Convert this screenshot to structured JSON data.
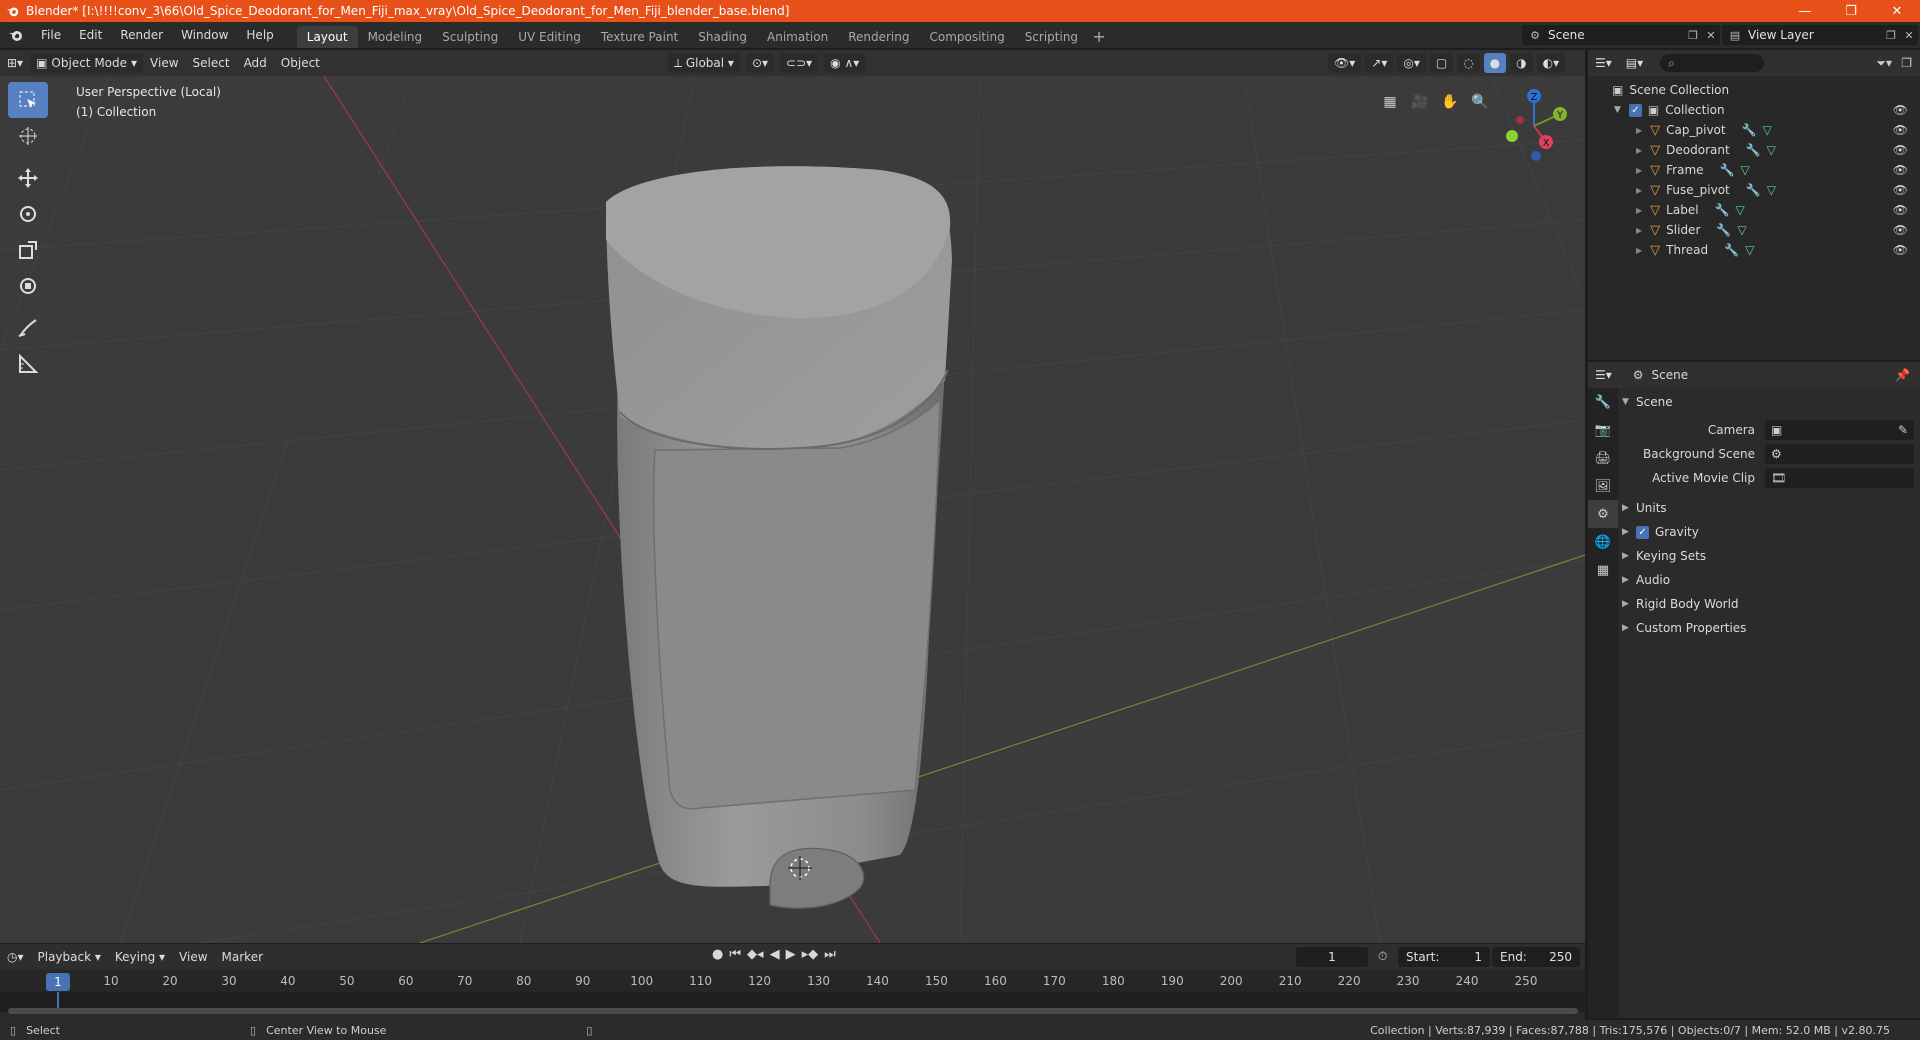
{
  "window": {
    "title": "Blender* [I:\\!!!!conv_3\\66\\Old_Spice_Deodorant_for_Men_Fiji_max_vray\\Old_Spice_Deodorant_for_Men_Fiji_blender_base.blend]",
    "controls": [
      "—",
      "❐",
      "✕"
    ]
  },
  "menu": [
    "File",
    "Edit",
    "Render",
    "Window",
    "Help"
  ],
  "workspaces": [
    "Layout",
    "Modeling",
    "Sculpting",
    "UV Editing",
    "Texture Paint",
    "Shading",
    "Animation",
    "Rendering",
    "Compositing",
    "Scripting"
  ],
  "active_workspace": "Layout",
  "scene_selector": "Scene",
  "view_layer_selector": "View Layer",
  "viewport": {
    "mode": "Object Mode",
    "menus": [
      "View",
      "Select",
      "Add",
      "Object"
    ],
    "transform_orientation": "Global",
    "info_line1": "User Perspective (Local)",
    "info_line2": "(1) Collection",
    "gizmo_axes": {
      "x": "X",
      "y": "Y",
      "z": "Z"
    }
  },
  "outliner": {
    "root": "Scene Collection",
    "collection": "Collection",
    "objects": [
      "Cap_pivot",
      "Deodorant",
      "Frame",
      "Fuse_pivot",
      "Label",
      "Slider",
      "Thread"
    ]
  },
  "properties": {
    "header": "Scene",
    "panel_title": "Scene",
    "fields": [
      {
        "label": "Camera",
        "value": ""
      },
      {
        "label": "Background Scene",
        "value": ""
      },
      {
        "label": "Active Movie Clip",
        "value": ""
      }
    ],
    "subpanels": [
      "Units",
      "Gravity",
      "Keying Sets",
      "Audio",
      "Rigid Body World",
      "Custom Properties"
    ],
    "gravity_checked": true
  },
  "timeline": {
    "menus": [
      "Playback",
      "Keying",
      "View",
      "Marker"
    ],
    "current_frame": "1",
    "start_label": "Start:",
    "start_value": "1",
    "end_label": "End:",
    "end_value": "250",
    "ruler": [
      "1",
      "10",
      "20",
      "30",
      "40",
      "50",
      "60",
      "70",
      "80",
      "90",
      "100",
      "110",
      "120",
      "130",
      "140",
      "150",
      "160",
      "170",
      "180",
      "190",
      "200",
      "210",
      "220",
      "230",
      "240",
      "250"
    ]
  },
  "status": {
    "left_action": "Select",
    "middle_action": "Center View to Mouse",
    "stats": "Collection | Verts:87,939 | Faces:87,788 | Tris:175,576 | Objects:0/7 | Mem: 52.0 MB | v2.80.75"
  }
}
